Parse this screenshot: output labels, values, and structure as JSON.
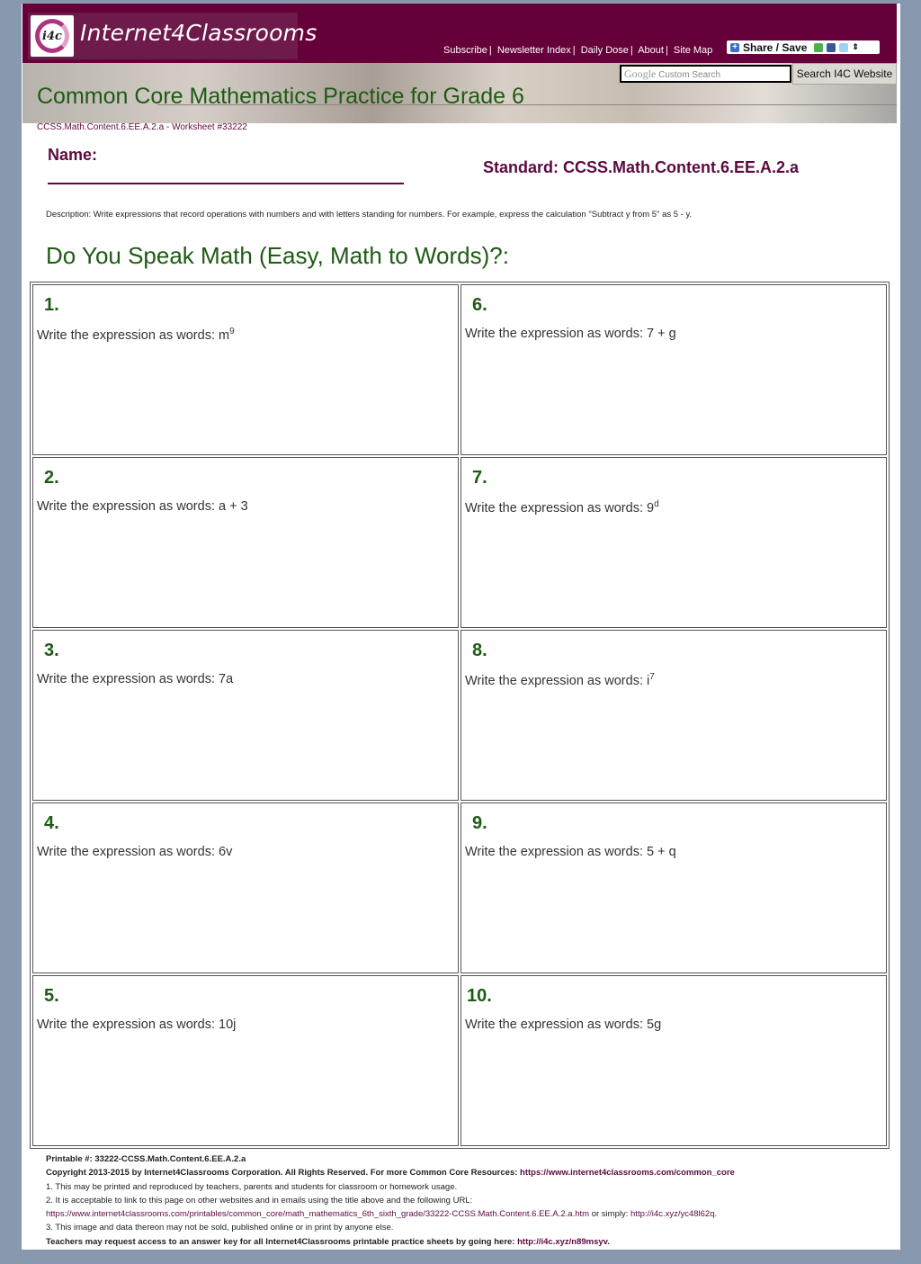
{
  "header": {
    "logo_badge": "i4c",
    "logo_text": "Internet4Classrooms",
    "links": [
      "Subscribe",
      "Newsletter Index",
      "Daily Dose",
      "About",
      "Site Map"
    ],
    "share_label": "Share / Save",
    "search_placeholder_brand": "Google",
    "search_placeholder": "Custom Search",
    "search_button": "Search I4C Website"
  },
  "page": {
    "title": "Common Core Mathematics Practice for Grade 6",
    "worksheet_id": "CCSS.Math.Content.6.EE.A.2.a - Worksheet #33222",
    "name_label": "Name:",
    "standard": "Standard: CCSS.Math.Content.6.EE.A.2.a",
    "description": "Description: Write expressions that record operations with numbers and with letters standing for numbers. For example, express the calculation \"Subtract y from 5\" as 5 - y.",
    "section_heading": "Do You Speak Math (Easy, Math to Words)?:"
  },
  "questions": [
    {
      "number": "1.",
      "prompt": "Write the expression as words: ",
      "base": "m",
      "exp": "9"
    },
    {
      "number": "2.",
      "prompt": "Write the expression as words: ",
      "base": "a + 3",
      "exp": ""
    },
    {
      "number": "3.",
      "prompt": "Write the expression as words: ",
      "base": "7a",
      "exp": ""
    },
    {
      "number": "4.",
      "prompt": "Write the expression as words: ",
      "base": "6v",
      "exp": ""
    },
    {
      "number": "5.",
      "prompt": "Write the expression as words: ",
      "base": "10j",
      "exp": ""
    },
    {
      "number": "6.",
      "prompt": "Write the expression as words: ",
      "base": "7 + g",
      "exp": ""
    },
    {
      "number": "7.",
      "prompt": "Write the expression as words: ",
      "base": "9",
      "exp": "d"
    },
    {
      "number": "8.",
      "prompt": "Write the expression as words: ",
      "base": "i",
      "exp": "7"
    },
    {
      "number": "9.",
      "prompt": "Write the expression as words: ",
      "base": "5 + q",
      "exp": ""
    },
    {
      "number": "10.",
      "prompt": "Write the expression as words: ",
      "base": "5g",
      "exp": ""
    }
  ],
  "footer": {
    "printable": "Printable #: 33222-CCSS.Math.Content.6.EE.A.2.a",
    "copyright": "Copyright 2013-2015 by Internet4Classrooms Corporation. All Rights Reserved. For more Common Core Resources: ",
    "copyright_link": "https://www.internet4classrooms.com/common_core",
    "note1": "1. This may be printed and reproduced by teachers, parents and students for classroom or homework usage.",
    "note2": "2. It is acceptable to link to this page on other websites and in emails using the title above and the following URL:",
    "url_long": "https://www.internet4classrooms.com/printables/common_core/math_mathematics_6th_sixth_grade/33222-CCSS.Math.Content.6.EE.A.2.a.htm",
    "or_simply": " or simply: ",
    "url_short": "http://i4c.xyz/yc48l62q.",
    "note3": "3. This image and data thereon may not be sold, published online or in print by anyone else.",
    "answer_key": "Teachers may request access to an answer key for all Internet4Classrooms printable practice sheets by going here: ",
    "answer_key_link": "http://i4c.xyz/n89msyv."
  }
}
